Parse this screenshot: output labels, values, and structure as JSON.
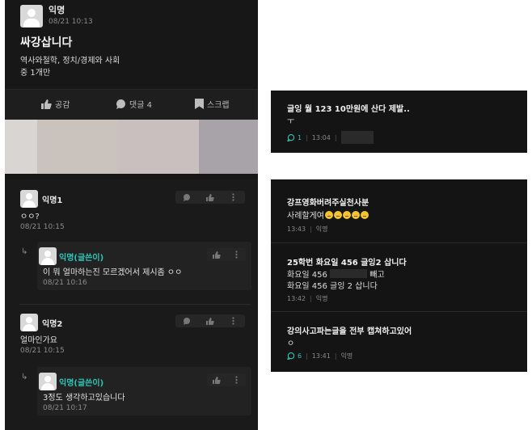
{
  "post": {
    "author": "익명",
    "time": "08/21 10:13",
    "title": "싸강삽니다",
    "body_line1": "역사와철학, 정치/경제와 사회",
    "body_line2": "중 1개만",
    "actions": {
      "like": "공감",
      "comment": "댓글 4",
      "scrap": "스크랩"
    }
  },
  "comments": [
    {
      "author": "익명1",
      "text": "ㅇㅇ?",
      "time": "08/21 10:15",
      "reply": {
        "author": "익명(글쓴이)",
        "text": "이 뭐 얼마하는진 모르겠어서 제시좀 ㅇㅇ",
        "time": "08/21 10:16"
      }
    },
    {
      "author": "익명2",
      "text": "얼마인가요",
      "time": "08/21 10:15",
      "reply": {
        "author": "익명(글쓴이)",
        "text": "3정도 생각하고있습니다",
        "time": "08/21 10:17"
      }
    }
  ],
  "right_card1": {
    "title": "글잉 월 123 10만원에 산다 제발..",
    "line2": "ㅜ",
    "comment_count": "1",
    "time": "13:04"
  },
  "right_card2": {
    "posts": [
      {
        "title": "강프영화버려주실천사분",
        "body": "사례할게여",
        "time": "13:43",
        "author": "익명"
      },
      {
        "title": "25학번 화요일 456  글잉2 삽니다",
        "body1a": "화요일 456",
        "body1b": "빼고",
        "body2": "화요일 456 글잉 2 삽니다",
        "time": "13:42",
        "author": "익명"
      },
      {
        "title": "강의사고파는글을 전부 캡쳐하고있어",
        "body": "ㅇ",
        "comment_count": "6",
        "time": "13:41",
        "author": "익명"
      }
    ]
  },
  "colors": {
    "panel": "#171717",
    "accent": "#2ec4b6",
    "muted": "#8a8a8a",
    "emoji": "#f4c430"
  },
  "icons": [
    "avatar-icon",
    "like-icon",
    "comment-icon",
    "scrap-icon",
    "more-icon",
    "reply-arrow-icon",
    "emoji-icon"
  ]
}
